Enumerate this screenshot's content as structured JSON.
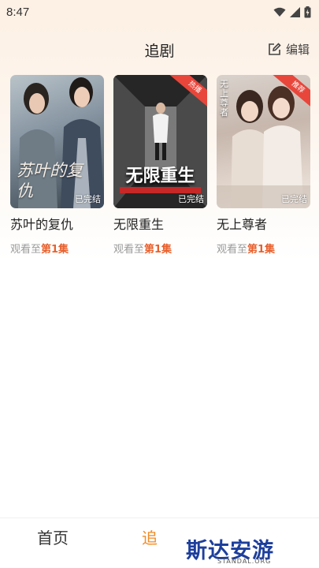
{
  "status_bar": {
    "time": "8:47"
  },
  "header": {
    "title": "追剧",
    "edit_label": "编辑"
  },
  "dramas": [
    {
      "cover_title": "苏叶的复仇",
      "badge": "已完结",
      "title": "苏叶的复仇",
      "progress_prefix": "观看至",
      "progress_episode": "第1集"
    },
    {
      "cover_title": "无限重生",
      "badge": "已完结",
      "ribbon": "热播",
      "title": "无限重生",
      "progress_prefix": "观看至",
      "progress_episode": "第1集"
    },
    {
      "cover_title": "无上尊者",
      "badge": "已完结",
      "ribbon": "推荐",
      "title": "无上尊者",
      "progress_prefix": "观看至",
      "progress_episode": "第1集"
    }
  ],
  "bottom_nav": {
    "home": "首页",
    "follow": "追"
  },
  "watermark": {
    "text": "斯达安游网",
    "sub": "STANDAL.ORG"
  },
  "colors": {
    "accent": "#f08a23",
    "episode": "#e8602c",
    "ribbon": "#e8463b"
  }
}
